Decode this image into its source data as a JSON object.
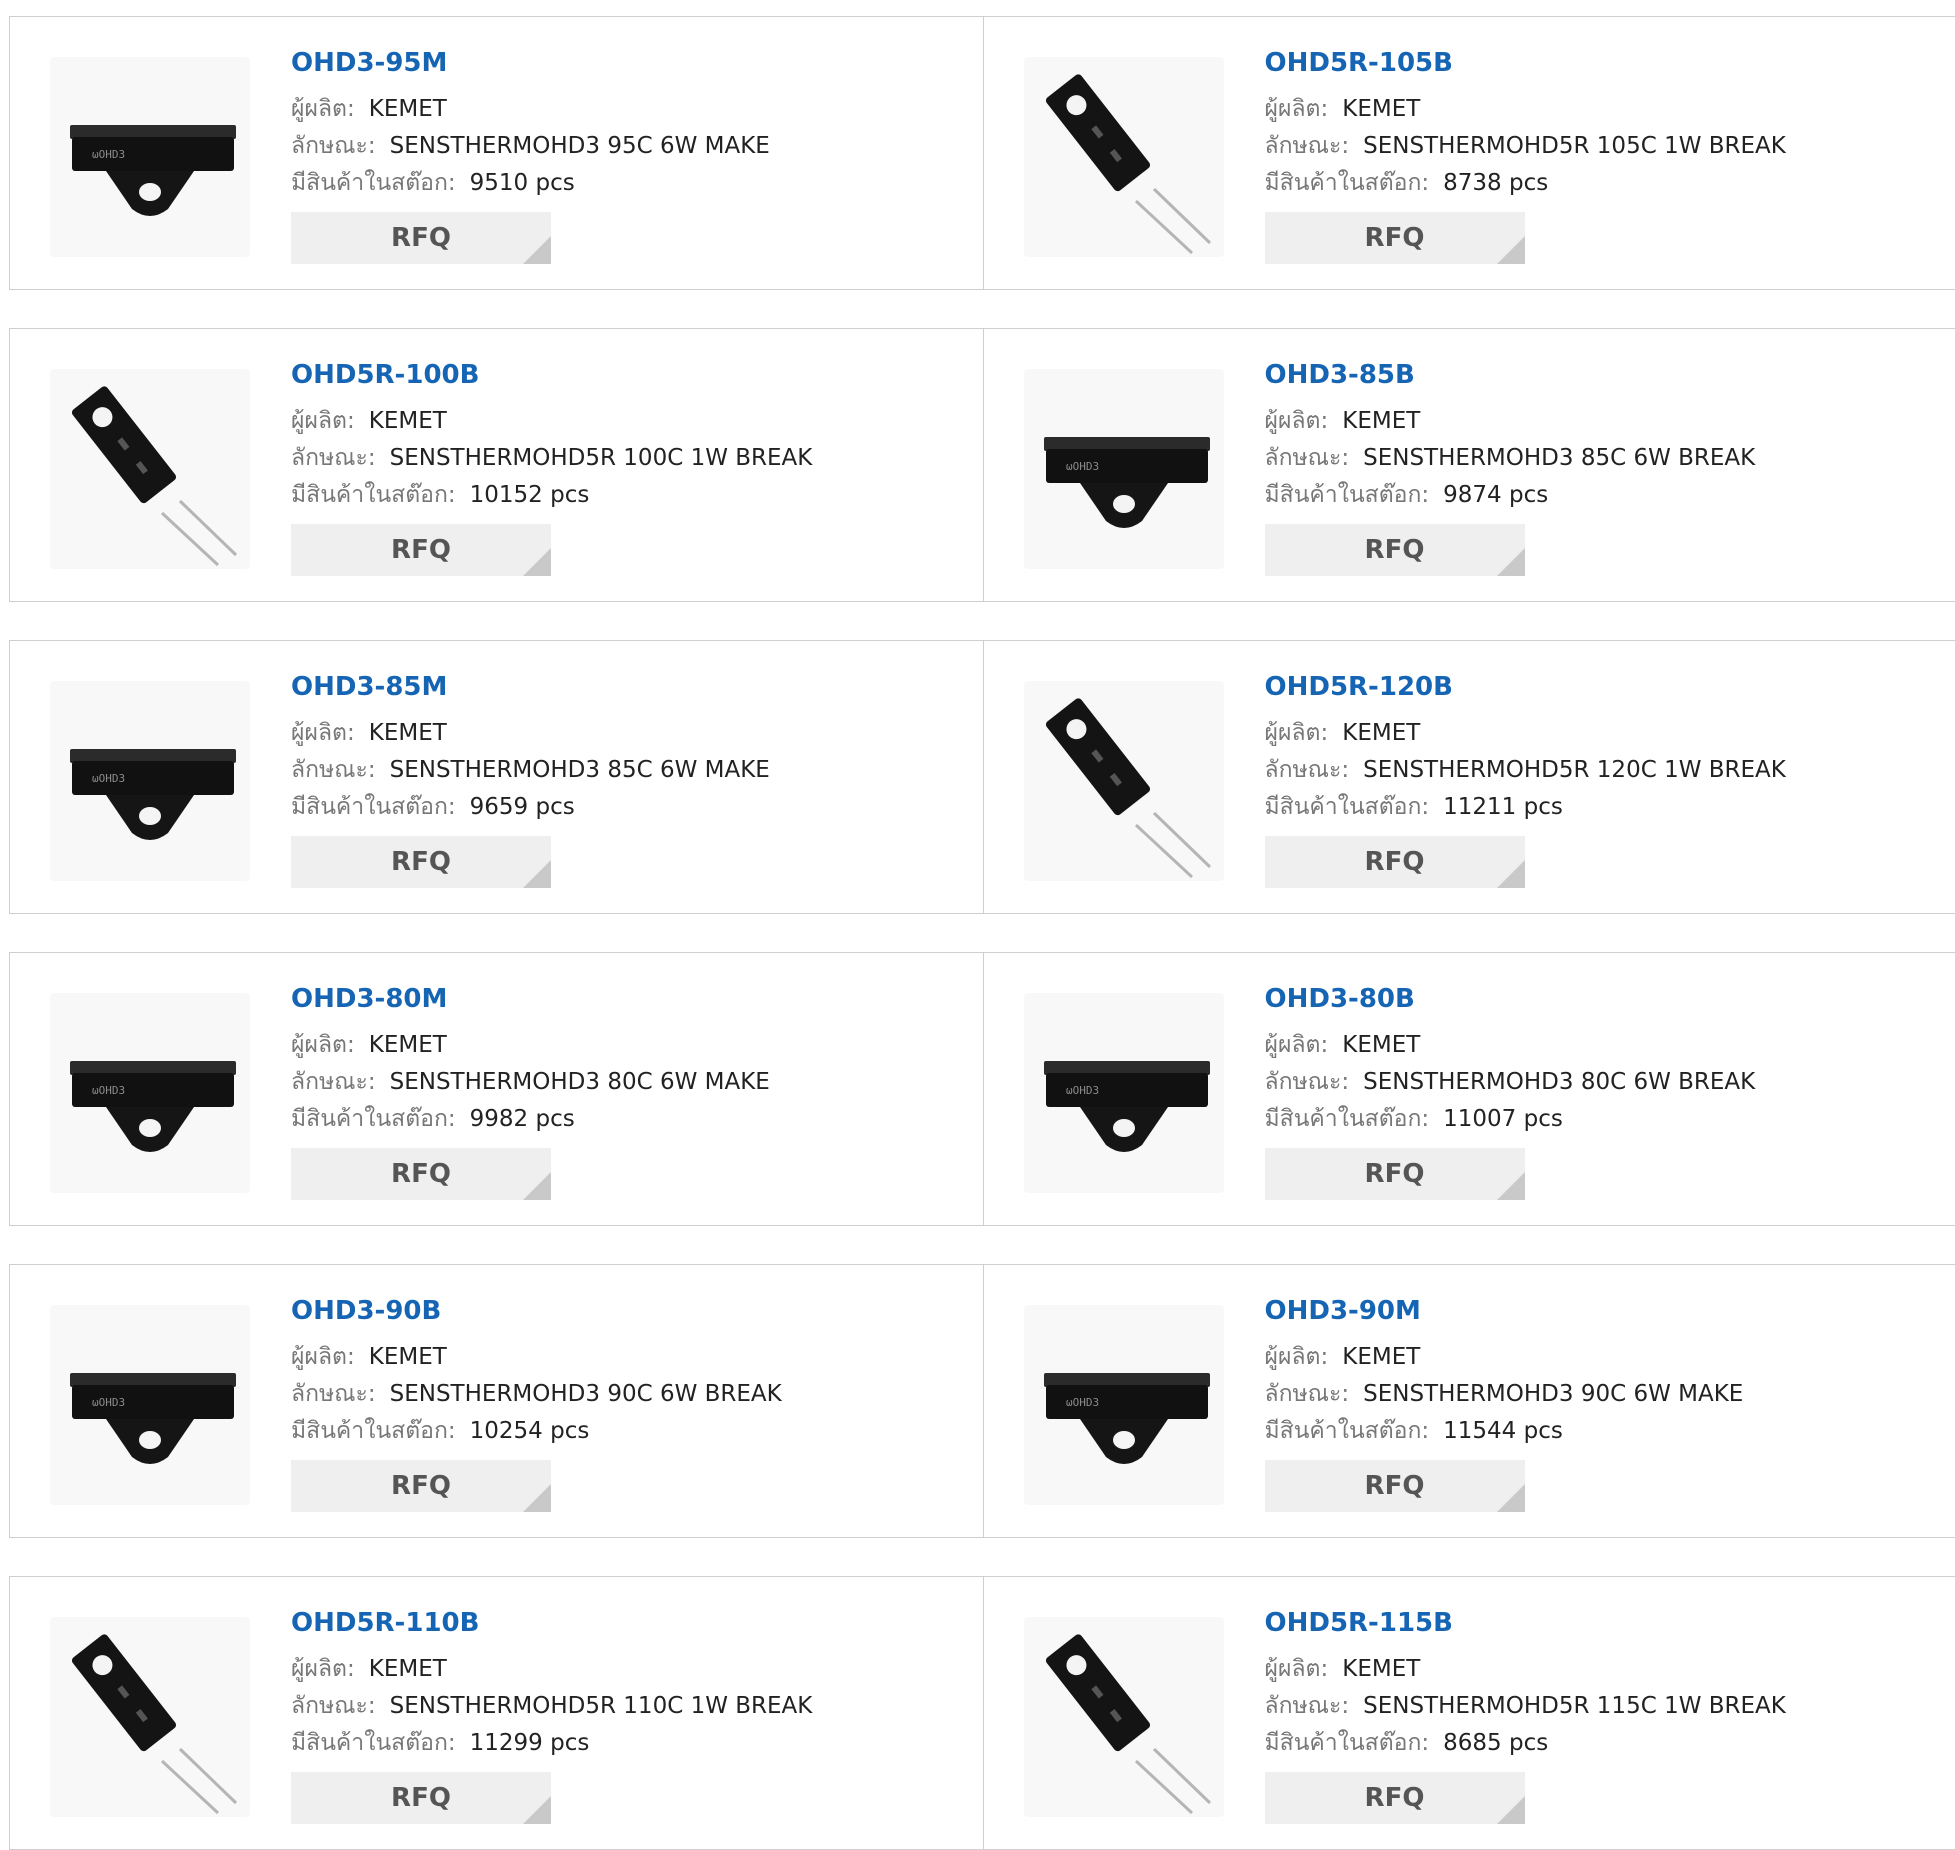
{
  "labels": {
    "manufacturer": "ผู้ผลิต:",
    "description": "ลักษณะ:",
    "stock": "มีสินค้าในสต๊อก:",
    "rfq": "RFQ"
  },
  "products": [
    {
      "part": "OHD3-95M",
      "manufacturer": "KEMET",
      "description": "SENSTHERMOHD3 95C 6W MAKE",
      "stock": "9510 pcs",
      "image": "ohd3-icon"
    },
    {
      "part": "OHD5R-105B",
      "manufacturer": "KEMET",
      "description": "SENSTHERMOHD5R 105C 1W BREAK",
      "stock": "8738 pcs",
      "image": "ohd5r-icon"
    },
    {
      "part": "OHD5R-100B",
      "manufacturer": "KEMET",
      "description": "SENSTHERMOHD5R 100C 1W BREAK",
      "stock": "10152 pcs",
      "image": "ohd5r-icon"
    },
    {
      "part": "OHD3-85B",
      "manufacturer": "KEMET",
      "description": "SENSTHERMOHD3 85C 6W BREAK",
      "stock": "9874 pcs",
      "image": "ohd3-icon"
    },
    {
      "part": "OHD3-85M",
      "manufacturer": "KEMET",
      "description": "SENSTHERMOHD3 85C 6W MAKE",
      "stock": "9659 pcs",
      "image": "ohd3-icon"
    },
    {
      "part": "OHD5R-120B",
      "manufacturer": "KEMET",
      "description": "SENSTHERMOHD5R 120C 1W BREAK",
      "stock": "11211 pcs",
      "image": "ohd5r-icon"
    },
    {
      "part": "OHD3-80M",
      "manufacturer": "KEMET",
      "description": "SENSTHERMOHD3 80C 6W MAKE",
      "stock": "9982 pcs",
      "image": "ohd3-icon"
    },
    {
      "part": "OHD3-80B",
      "manufacturer": "KEMET",
      "description": "SENSTHERMOHD3 80C 6W BREAK",
      "stock": "11007 pcs",
      "image": "ohd3-icon"
    },
    {
      "part": "OHD3-90B",
      "manufacturer": "KEMET",
      "description": "SENSTHERMOHD3 90C 6W BREAK",
      "stock": "10254 pcs",
      "image": "ohd3-icon"
    },
    {
      "part": "OHD3-90M",
      "manufacturer": "KEMET",
      "description": "SENSTHERMOHD3 90C 6W MAKE",
      "stock": "11544 pcs",
      "image": "ohd3-icon"
    },
    {
      "part": "OHD5R-110B",
      "manufacturer": "KEMET",
      "description": "SENSTHERMOHD5R 110C 1W BREAK",
      "stock": "11299 pcs",
      "image": "ohd5r-icon"
    },
    {
      "part": "OHD5R-115B",
      "manufacturer": "KEMET",
      "description": "SENSTHERMOHD5R 115C 1W BREAK",
      "stock": "8685 pcs",
      "image": "ohd5r-icon"
    }
  ],
  "colors": {
    "part_link": "#1565b4",
    "label_text": "#777777",
    "border": "#cfcfcf",
    "button_bg": "#efefef"
  }
}
